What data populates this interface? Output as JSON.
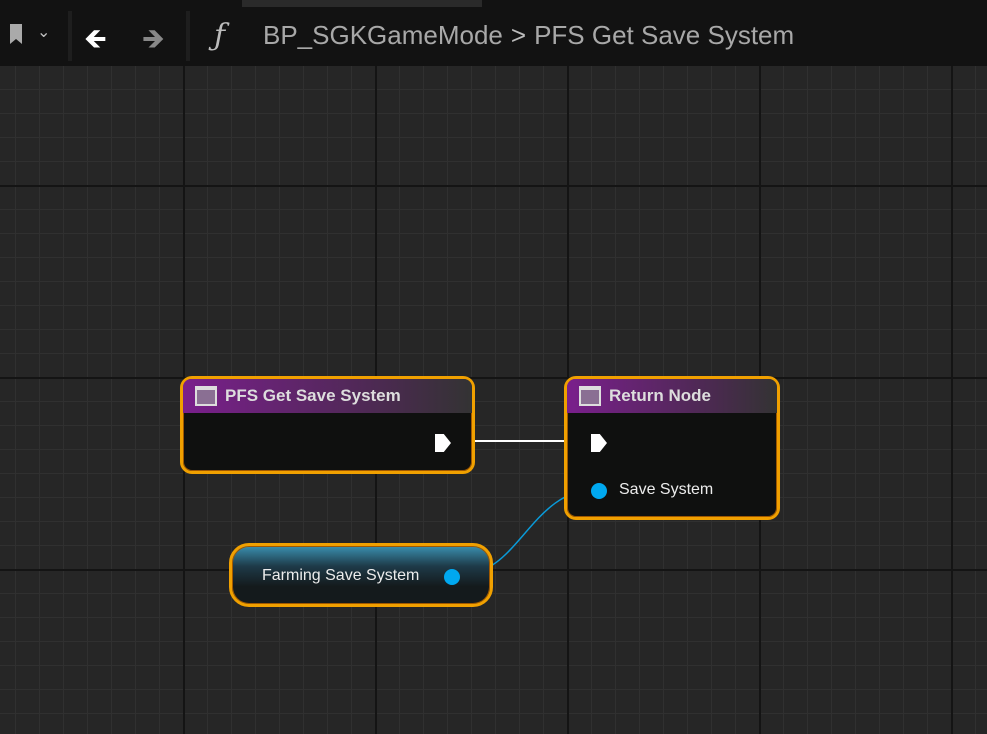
{
  "toolbar": {
    "bookmark_icon": "bookmark-icon",
    "back_icon": "arrow-left-icon",
    "forward_icon": "arrow-right-icon",
    "function_icon": "ƒ"
  },
  "breadcrumb": {
    "parent": "BP_SGKGameMode",
    "separator": ">",
    "current": "PFS Get Save System"
  },
  "nodes": {
    "entry": {
      "title": "PFS Get Save System"
    },
    "return": {
      "title": "Return Node",
      "pin_label": "Save System"
    },
    "variable": {
      "label": "Farming Save System"
    }
  },
  "colors": {
    "accent": "#f0a000",
    "function_header": "#7a1f8c",
    "object_pin": "#00a8f0"
  }
}
